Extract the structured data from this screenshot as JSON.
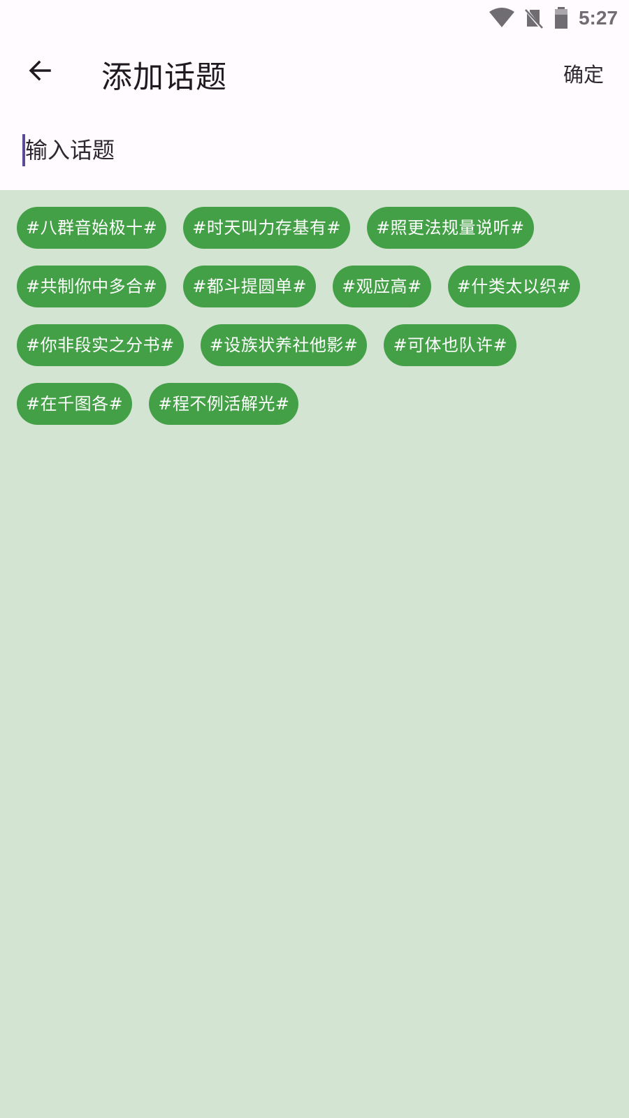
{
  "status_bar": {
    "time": "5:27",
    "icons": [
      "wifi-icon",
      "no-sim-icon",
      "battery-icon"
    ]
  },
  "app_bar": {
    "back_icon": "arrow-left-icon",
    "title": "添加话题",
    "confirm_label": "确定"
  },
  "input": {
    "placeholder": "输入话题",
    "value": ""
  },
  "topics": [
    "#八群音始极十#",
    "#时天叫力存基有#",
    "#照更法规量说听#",
    "#共制你中多合#",
    "#都斗提圆单#",
    "#观应高#",
    "#什类太以织#",
    "#你非段实之分书#",
    "#设族状养社他影#",
    "#可体也队许#",
    "#在千图各#",
    "#程不例活解光#"
  ],
  "colors": {
    "chip_bg": "#43a047",
    "page_bg": "#d3e4d2",
    "header_bg": "#fffbfe",
    "cursor": "#5b4a97"
  }
}
